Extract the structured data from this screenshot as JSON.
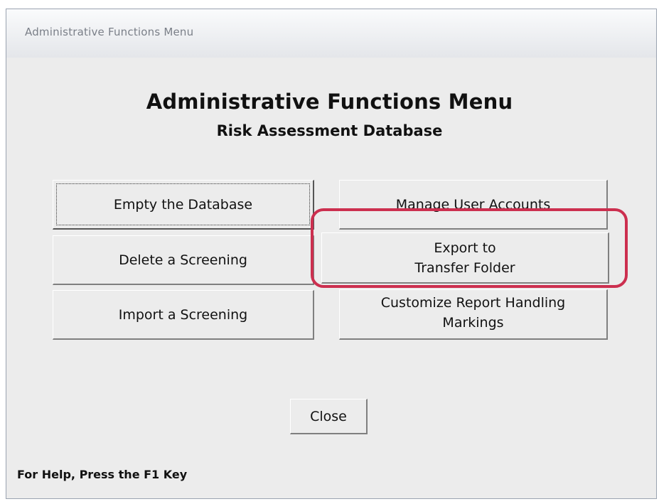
{
  "window": {
    "title": "Administrative Functions Menu"
  },
  "header": {
    "title": "Administrative Functions Menu",
    "subtitle": "Risk Assessment Database"
  },
  "buttons": {
    "empty_database": "Empty the Database",
    "delete_screening": "Delete a Screening",
    "import_screening": "Import a Screening",
    "manage_users": "Manage User Accounts",
    "export_line1": "Export to",
    "export_line2": "Transfer Folder",
    "customize_line1": "Customize Report Handling",
    "customize_line2": "Markings",
    "close": "Close"
  },
  "status_bar": {
    "help_text": "For Help, Press the F1 Key"
  },
  "colors": {
    "highlight": "#cc2f4f",
    "background": "#ececec"
  }
}
